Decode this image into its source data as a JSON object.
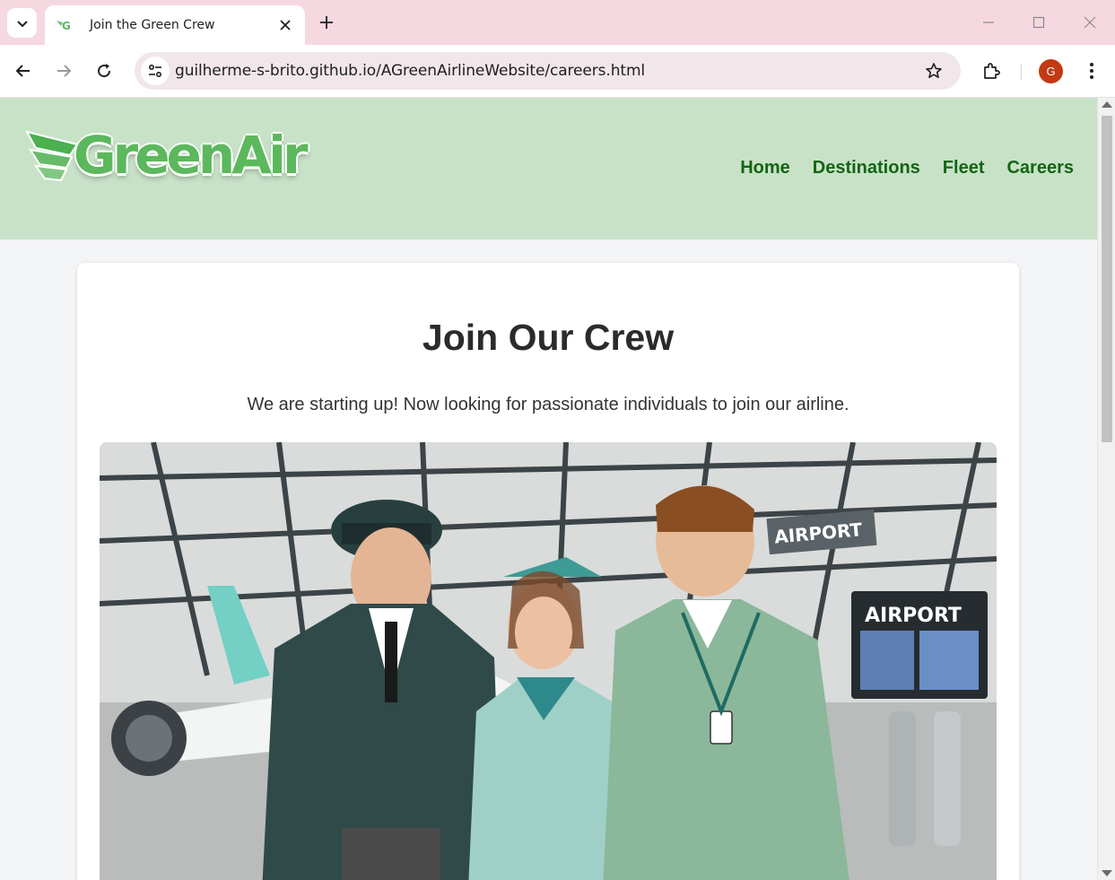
{
  "browser": {
    "tab_title": "Join the Green Crew",
    "url": "guilherme-s-brito.github.io/AGreenAirlineWebsite/careers.html",
    "profile_initial": "G"
  },
  "site": {
    "logo_text": "GreenAir",
    "nav": [
      "Home",
      "Destinations",
      "Fleet",
      "Careers"
    ]
  },
  "main": {
    "heading": "Join Our Crew",
    "intro": "We are starting up! Now looking for passionate individuals to join our airline.",
    "hero_signs": [
      "AIRPORT",
      "AIRPORT"
    ]
  },
  "colors": {
    "header_bg": "#c8e2c8",
    "nav_link": "#146414",
    "logo_green": "#5cb85c"
  }
}
